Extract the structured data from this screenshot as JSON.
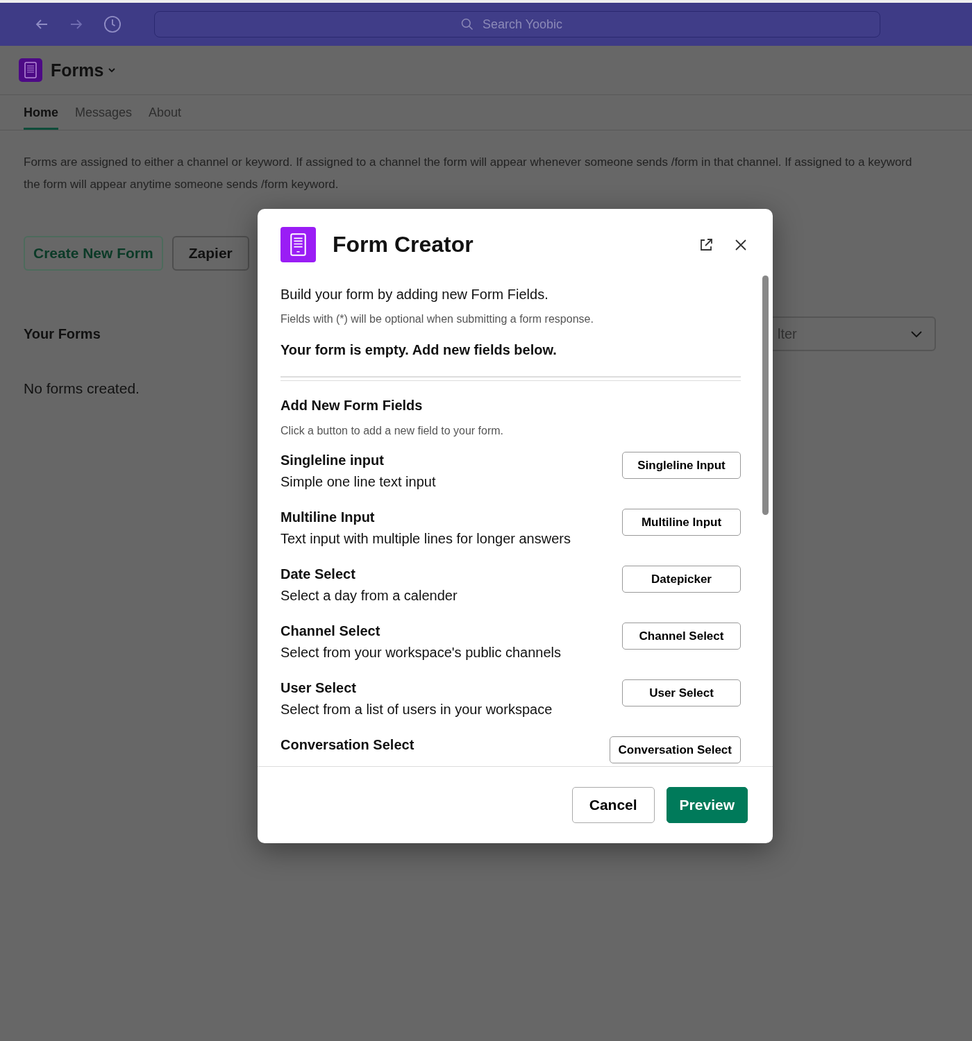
{
  "top_bar": {
    "search": {
      "placeholder": "Search Yoobic"
    }
  },
  "app": {
    "title": "Forms"
  },
  "tabs": [
    {
      "label": "Home",
      "selected": true
    },
    {
      "label": "Messages",
      "selected": false
    },
    {
      "label": "About",
      "selected": false
    }
  ],
  "intro": "Forms are assigned to either a channel or keyword. If assigned to a channel the form will appear whenever someone sends /form in that channel. If assigned to a keyword the form will appear anytime someone sends /form keyword.",
  "actions": [
    {
      "label": "Create New Form",
      "kind": "primary"
    },
    {
      "label": "Zapier",
      "kind": "plain"
    }
  ],
  "your_forms": {
    "title": "Your Forms",
    "empty": "No forms created.",
    "filter": {
      "value": "lter"
    }
  },
  "modal": {
    "title": "Form Creator",
    "lead": "Build your form by adding new Form Fields.",
    "hint": "Fields with (*) will be optional when submitting a form response.",
    "status": "Your form is empty. Add new fields below.",
    "section_title": "Add New Form Fields",
    "section_hint": "Click a button to add a new field to your form.",
    "fields": [
      {
        "name": "Singleline input",
        "description": "Simple one line text input",
        "button": "Singleline Input"
      },
      {
        "name": "Multiline Input",
        "description": "Text input with multiple lines for longer answers",
        "button": "Multiline Input"
      },
      {
        "name": "Date Select",
        "description": "Select a day from a calender",
        "button": "Datepicker"
      },
      {
        "name": "Channel Select",
        "description": "Select from your workspace's public channels",
        "button": "Channel Select"
      },
      {
        "name": "User Select",
        "description": "Select from a list of users in your workspace",
        "button": "User Select"
      },
      {
        "name": "Conversation Select",
        "button": "Conversation Select"
      }
    ],
    "buttons": [
      {
        "label": "Cancel",
        "kind": "secondary"
      },
      {
        "label": "Preview",
        "kind": "primary"
      }
    ]
  }
}
